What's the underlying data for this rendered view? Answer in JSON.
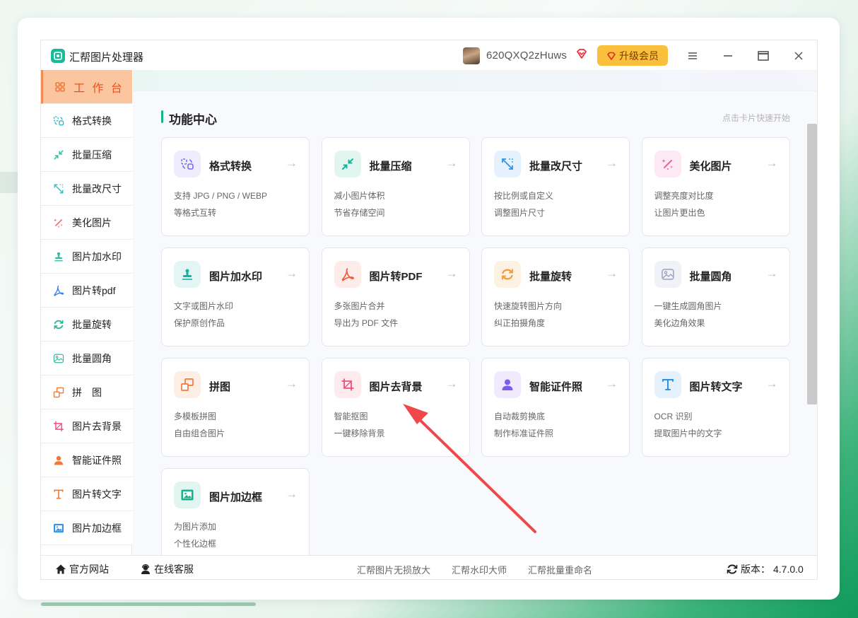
{
  "app": {
    "title": "汇帮图片处理器"
  },
  "user": {
    "name": "620QXQ2zHuws"
  },
  "upgrade": {
    "label": "升级会员"
  },
  "sidebar": {
    "items": [
      {
        "label": "工 作 台",
        "icon": "dashboard-icon",
        "active": true
      },
      {
        "label": "格式转换",
        "icon": "convert-icon"
      },
      {
        "label": "批量压缩",
        "icon": "compress-icon"
      },
      {
        "label": "批量改尺寸",
        "icon": "resize-icon"
      },
      {
        "label": "美化图片",
        "icon": "beautify-icon"
      },
      {
        "label": "图片加水印",
        "icon": "watermark-icon"
      },
      {
        "label": "图片转pdf",
        "icon": "pdf-icon"
      },
      {
        "label": "批量旋转",
        "icon": "rotate-icon"
      },
      {
        "label": "批量圆角",
        "icon": "round-corner-icon"
      },
      {
        "label": "拼　图",
        "icon": "collage-icon"
      },
      {
        "label": "图片去背景",
        "icon": "crop-icon"
      },
      {
        "label": "智能证件照",
        "icon": "id-photo-icon"
      },
      {
        "label": "图片转文字",
        "icon": "text-icon"
      },
      {
        "label": "图片加边框",
        "icon": "frame-icon"
      }
    ]
  },
  "main": {
    "section_title": "功能中心",
    "section_hint": "点击卡片快速开始",
    "arrow": "→",
    "cards": [
      {
        "title": "格式转换",
        "desc1": "支持 JPG / PNG / WEBP",
        "desc2": "等格式互转",
        "icon": "convert-icon"
      },
      {
        "title": "批量压缩",
        "desc1": "减小图片体积",
        "desc2": "节省存储空间",
        "icon": "compress-icon"
      },
      {
        "title": "批量改尺寸",
        "desc1": "按比例或自定义",
        "desc2": "调整图片尺寸",
        "icon": "resize-icon"
      },
      {
        "title": "美化图片",
        "desc1": "调整亮度对比度",
        "desc2": "让图片更出色",
        "icon": "beautify-icon"
      },
      {
        "title": "图片加水印",
        "desc1": "文字或图片水印",
        "desc2": "保护原创作品",
        "icon": "watermark-icon"
      },
      {
        "title": "图片转PDF",
        "desc1": "多张图片合并",
        "desc2": "导出为 PDF 文件",
        "icon": "pdf-icon"
      },
      {
        "title": "批量旋转",
        "desc1": "快速旋转图片方向",
        "desc2": "纠正拍摄角度",
        "icon": "rotate-icon"
      },
      {
        "title": "批量圆角",
        "desc1": "一键生成圆角图片",
        "desc2": "美化边角效果",
        "icon": "round-corner-icon"
      },
      {
        "title": "拼图",
        "desc1": "多模板拼图",
        "desc2": "自由组合图片",
        "icon": "collage-icon"
      },
      {
        "title": "图片去背景",
        "desc1": "智能抠图",
        "desc2": "一键移除背景",
        "icon": "crop-icon"
      },
      {
        "title": "智能证件照",
        "desc1": "自动裁剪换底",
        "desc2": "制作标准证件照",
        "icon": "id-photo-icon"
      },
      {
        "title": "图片转文字",
        "desc1": "OCR 识别",
        "desc2": "提取图片中的文字",
        "icon": "text-icon"
      },
      {
        "title": "图片加边框",
        "desc1": "为图片添加",
        "desc2": "个性化边框",
        "icon": "frame-icon"
      }
    ]
  },
  "footer": {
    "website": "官方网站",
    "support": "在线客服",
    "links": [
      "汇帮图片无损放大",
      "汇帮水印大师",
      "汇帮批量重命名"
    ],
    "version_label": "版本：",
    "version": "4.7.0.0"
  },
  "colors": {
    "accent": "#14b38a",
    "active_bg": "#fbc59f",
    "active_text": "#e8521c",
    "upgrade_bg": "#fbbf3e",
    "annotation_arrow": "#f0484a"
  }
}
